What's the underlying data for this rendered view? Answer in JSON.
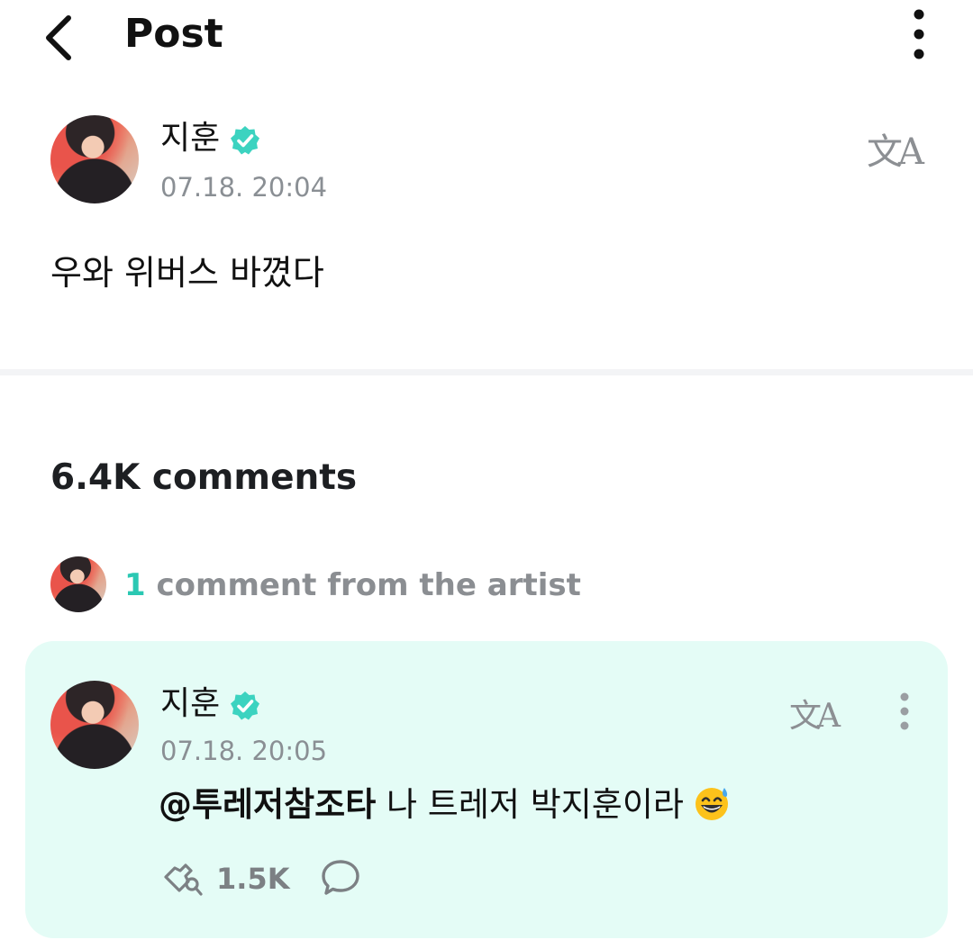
{
  "header": {
    "title": "Post"
  },
  "post": {
    "author": "지훈",
    "timestamp": "07.18. 20:04",
    "content": "우와 위버스 바꼈다",
    "translate_glyph": "文A"
  },
  "comments": {
    "count_label": "6.4K comments",
    "artist_summary": {
      "count": "1",
      "label": " comment from the artist"
    },
    "items": [
      {
        "author": "지훈",
        "timestamp": "07.18. 20:05",
        "mention": "@투레저참조타",
        "text": " 나 트레저 박지훈이라",
        "likes": "1.5K",
        "translate_glyph": "文A"
      }
    ]
  },
  "colors": {
    "accent_teal": "#2bc8b3",
    "comment_card_bg": "#e4fcf6",
    "muted_text": "#8a8f94"
  },
  "icons": {
    "back": "chevron-left-icon",
    "more": "more-vertical-icon",
    "verified": "verified-badge-icon",
    "translate": "translate-icon",
    "like": "light-stick-icon",
    "reply": "chat-bubble-icon",
    "emoji": "grinning-face-with-sweat-emoji"
  }
}
